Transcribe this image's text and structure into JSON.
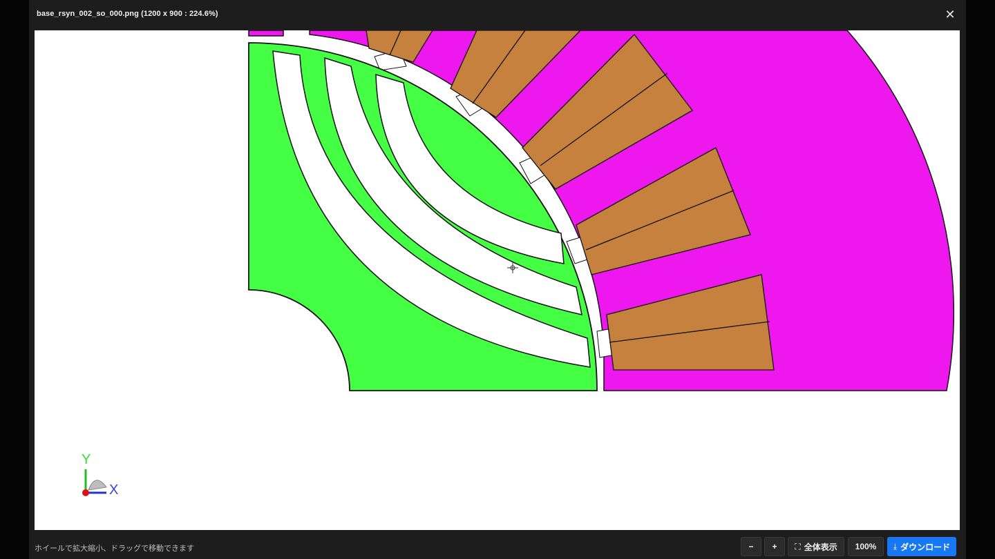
{
  "window": {
    "title": "base_rsyn_002_so_000.png (1200 x 900 : 224.6%)",
    "close_icon": "close-icon"
  },
  "footer": {
    "hint": "ホイールで拡大縮小、ドラッグで移動できます",
    "zoom_out_label": "−",
    "zoom_in_label": "+",
    "fit_label": "全体表示",
    "reset_label": "100%",
    "download_label": "ダウンロード"
  },
  "axes": {
    "y_label": "Y",
    "x_label": "X"
  },
  "colors": {
    "rotor": "#45ff45",
    "stator": "#ee17ee",
    "coil": "#c6813f",
    "barrier": "#ffffff",
    "download_button": "#1877f2"
  }
}
